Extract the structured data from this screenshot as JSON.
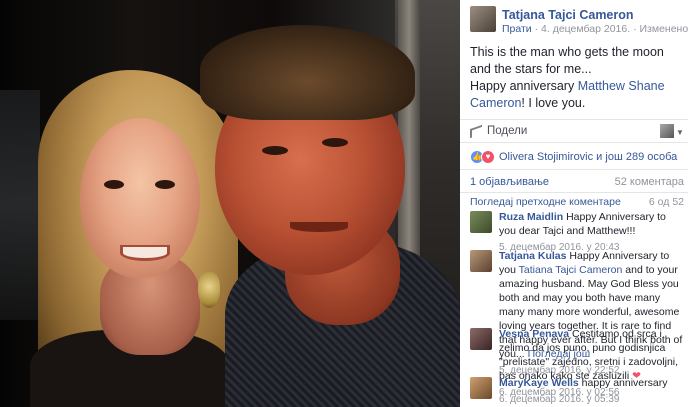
{
  "post": {
    "author": "Tatjana Tajci Cameron",
    "follow": "Прати",
    "date": "4. децембар 2016.",
    "edited": "Изменено",
    "text_line1": "This is the man who gets the moon and the stars for me...",
    "text_line2_prefix": "Happy anniversary ",
    "text_line2_link": "Matthew Shane Cameron",
    "text_line2_suffix": "! I love you.",
    "share_label": "Подели",
    "reactions_text": "Olivera Stojimirovic и још 289 особа",
    "shares_text": "1 објављивање",
    "comments_count_text": "52 коментара",
    "prev_comments_text": "Погледај претходне коментаре",
    "prev_comments_count": "6 од 52"
  },
  "comments": [
    {
      "name": "Ruza Maidlin",
      "text": " Happy Anniversary to you dear Tajci and Matthew!!!",
      "time": "5. децембар 2016. у 20:43",
      "avatar_colors": [
        "#7a8c5c",
        "#3d4a2a"
      ]
    },
    {
      "name": "Tatjana Kulas",
      "text_prefix": " Happy Anniversary to you ",
      "mention": "Tatiana Tajci Cameron",
      "text": " and to your amazing husband. May God Bless you both and may you both have many many many more wonderful, awesome loving years together. It is rare to find that happy ever after. But I think both of you... ",
      "more": "Погледај још",
      "time": "5. децембар 2016. у 22:52",
      "avatar_colors": [
        "#b89a78",
        "#5c4030"
      ]
    },
    {
      "name": "Vesna Penava",
      "text": " Cestitamo od srca i zelimo da jos puno, puno godisnjica \"prelistate\" zajedno, sretni i zadovoljni, bas onako kako ste zasluzili ",
      "heart": "❤",
      "time": "6. децембар 2016. у 02:56",
      "avatar_colors": [
        "#8d6a6a",
        "#3a2424"
      ]
    },
    {
      "name": "MaryKaye Wells",
      "text": " happy anniversary",
      "time": "6. децембар 2016. у 05:39",
      "avatar_colors": [
        "#d0a070",
        "#6a4a2a"
      ]
    }
  ]
}
